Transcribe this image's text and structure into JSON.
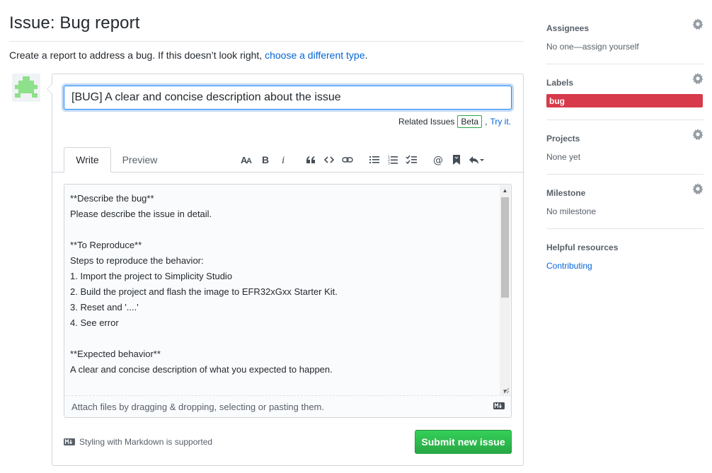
{
  "page": {
    "title": "Issue: Bug report",
    "intro_text": "Create a report to address a bug. If this doesn’t look right,",
    "intro_link": "choose a different type",
    "intro_end": "."
  },
  "form": {
    "title_value": "[BUG] A clear and concise description about the issue",
    "related_issues_label": "Related Issues",
    "beta_badge": "Beta",
    "try_it_link": "Try it.",
    "tabs": {
      "write": "Write",
      "preview": "Preview"
    },
    "toolbar_icons": [
      "text-size-icon",
      "bold-icon",
      "italic-icon",
      "quote-icon",
      "code-icon",
      "link-icon",
      "unordered-list-icon",
      "ordered-list-icon",
      "task-list-icon",
      "mention-icon",
      "bookmark-icon",
      "reply-icon"
    ],
    "body_text": "**Describe the bug**\nPlease describe the issue in detail.\n\n**To Reproduce**\nSteps to reproduce the behavior:\n1. Import the project to Simplicity Studio\n2. Build the project and flash the image to EFR32xGxx Starter Kit.\n3. Reset and '....'\n4. See error\n\n**Expected behavior**\nA clear and concise description of what you expected to happen.",
    "attach_text": "Attach files by dragging & dropping, selecting or pasting them.",
    "markdown_note": "Styling with Markdown is supported",
    "submit_label": "Submit new issue"
  },
  "sidebar": {
    "assignees": {
      "heading": "Assignees",
      "value": "No one—assign yourself"
    },
    "labels": {
      "heading": "Labels",
      "items": [
        {
          "name": "bug",
          "color": "#d73a4a"
        }
      ]
    },
    "projects": {
      "heading": "Projects",
      "value": "None yet"
    },
    "milestone": {
      "heading": "Milestone",
      "value": "No milestone"
    },
    "resources": {
      "heading": "Helpful resources",
      "link": "Contributing"
    }
  },
  "colors": {
    "link": "#0366d6",
    "submit_green": "#28a745",
    "label_bug": "#d73a4a",
    "focus_blue": "#2188ff",
    "avatar_green": "#8ee08a"
  }
}
